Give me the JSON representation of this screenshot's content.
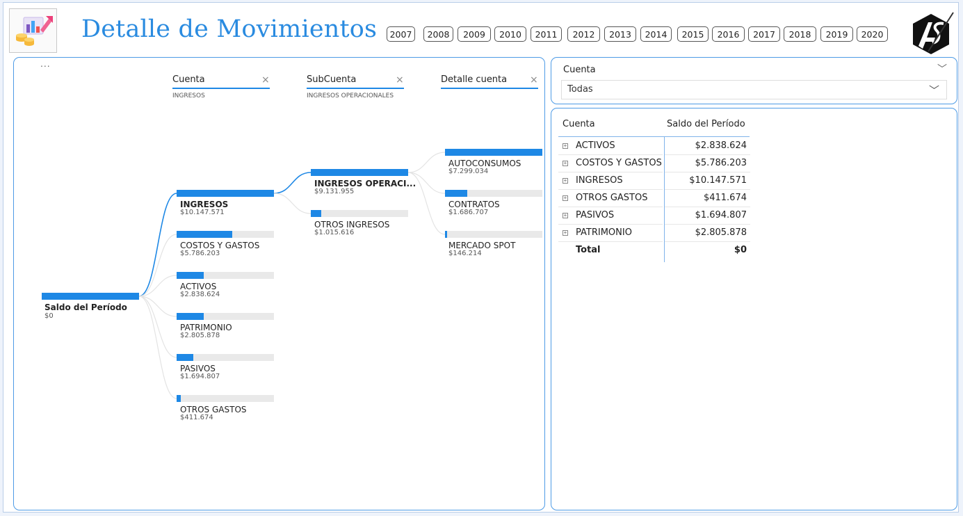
{
  "header": {
    "title": "Detalle de Movimientos",
    "years": [
      "2007",
      "2008",
      "2009",
      "2010",
      "2011",
      "2012",
      "2013",
      "2014",
      "2015",
      "2016",
      "2017",
      "2018",
      "2019",
      "2020"
    ]
  },
  "colors": {
    "accent": "#1e88e5",
    "bar_track": "#e9e9e9",
    "panel_border": "#4d9be6",
    "title": "#2a8be0"
  },
  "tree": {
    "more_options": "...",
    "root": {
      "label": "Saldo del Período",
      "value": "$0",
      "fraction": 1.0
    },
    "levels": [
      {
        "label": "Cuenta",
        "selected": "INGRESOS"
      },
      {
        "label": "SubCuenta",
        "selected": "INGRESOS OPERACIONALES"
      },
      {
        "label": "Detalle cuenta",
        "selected": ""
      }
    ],
    "cuenta_nodes": [
      {
        "label": "INGRESOS",
        "value": "$10.147.571",
        "fraction": 1.0,
        "selected": true
      },
      {
        "label": "COSTOS Y GASTOS",
        "value": "$5.786.203",
        "fraction": 0.57,
        "selected": false
      },
      {
        "label": "ACTIVOS",
        "value": "$2.838.624",
        "fraction": 0.28,
        "selected": false
      },
      {
        "label": "PATRIMONIO",
        "value": "$2.805.878",
        "fraction": 0.28,
        "selected": false
      },
      {
        "label": "PASIVOS",
        "value": "$1.694.807",
        "fraction": 0.17,
        "selected": false
      },
      {
        "label": "OTROS GASTOS",
        "value": "$411.674",
        "fraction": 0.04,
        "selected": false
      }
    ],
    "subcuenta_nodes": [
      {
        "label": "INGRESOS OPERACI...",
        "value": "$9.131.955",
        "fraction": 1.0,
        "selected": true
      },
      {
        "label": "OTROS INGRESOS",
        "value": "$1.015.616",
        "fraction": 0.11,
        "selected": false
      }
    ],
    "detalle_nodes": [
      {
        "label": "AUTOCONSUMOS",
        "value": "$7.299.034",
        "fraction": 1.0,
        "selected": false
      },
      {
        "label": "CONTRATOS",
        "value": "$1.686.707",
        "fraction": 0.23,
        "selected": false
      },
      {
        "label": "MERCADO SPOT",
        "value": "$146.214",
        "fraction": 0.02,
        "selected": false
      }
    ]
  },
  "filter": {
    "title": "Cuenta",
    "selected": "Todas"
  },
  "matrix": {
    "col_account": "Cuenta",
    "col_balance": "Saldo del Período",
    "rows": [
      {
        "name": "ACTIVOS",
        "value": "$2.838.624"
      },
      {
        "name": "COSTOS Y GASTOS",
        "value": "$5.786.203"
      },
      {
        "name": "INGRESOS",
        "value": "$10.147.571"
      },
      {
        "name": "OTROS GASTOS",
        "value": "$411.674"
      },
      {
        "name": "PASIVOS",
        "value": "$1.694.807"
      },
      {
        "name": "PATRIMONIO",
        "value": "$2.805.878"
      }
    ],
    "total_label": "Total",
    "total_value": "$0"
  }
}
